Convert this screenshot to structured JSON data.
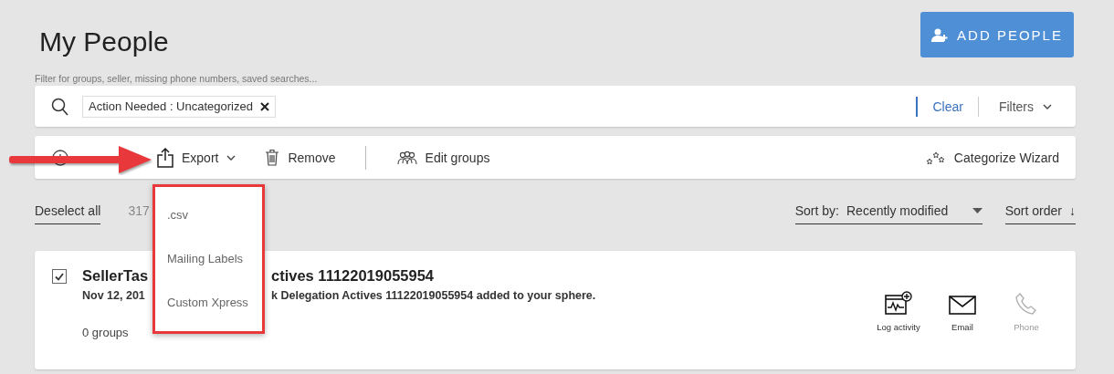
{
  "header": {
    "title": "My People",
    "add_button": "ADD PEOPLE"
  },
  "filter": {
    "hint": "Filter for groups, seller, missing phone numbers, saved searches...",
    "chips": [
      {
        "label": "Action Needed : Uncategorized"
      }
    ],
    "clear": "Clear",
    "filters": "Filters"
  },
  "toolbar": {
    "items": [
      {
        "kind": "add"
      },
      {
        "kind": "export",
        "label": "Export",
        "expanded": true
      },
      {
        "kind": "remove",
        "label": "Remove"
      },
      {
        "kind": "divider"
      },
      {
        "kind": "groups",
        "label": "Edit groups"
      }
    ],
    "wizard": "Categorize Wizard"
  },
  "export_menu": {
    "items": [
      ".csv",
      "Mailing Labels",
      "Custom Xpress"
    ]
  },
  "list_bar": {
    "deselect": "Deselect all",
    "count": "317",
    "sort_label": "Sort by:",
    "sort_value": "Recently modified",
    "sort_order": "Sort order",
    "sort_arrow": "↓"
  },
  "cards": [
    {
      "checked": true,
      "title_parts": [
        "SellerTas",
        "ctives 11122019055954"
      ],
      "detail_parts": [
        "Nov 12, 201",
        "k Delegation Actives 11122019055954 added to your sphere."
      ],
      "groups": "0 groups",
      "actions": [
        {
          "kind": "log",
          "label": "Log activity",
          "disabled": false
        },
        {
          "kind": "email",
          "label": "Email",
          "disabled": false
        },
        {
          "kind": "phone",
          "label": "Phone",
          "disabled": true
        }
      ]
    }
  ]
}
